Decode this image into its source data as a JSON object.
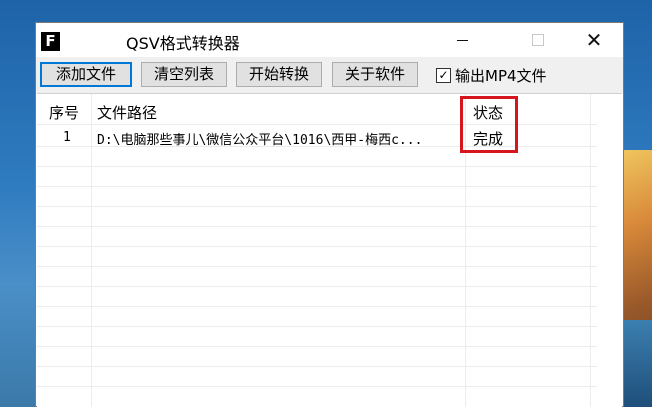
{
  "window": {
    "title": "QSV格式转换器",
    "icon_letter": "F"
  },
  "toolbar": {
    "add_file": "添加文件",
    "clear_list": "清空列表",
    "start_convert": "开始转换",
    "about": "关于软件",
    "output_mp4_label": "输出MP4文件",
    "output_mp4_checked": true
  },
  "table": {
    "columns": [
      "序号",
      "文件路径",
      "状态"
    ],
    "rows": [
      {
        "index": "1",
        "path": "D:\\电脑那些事儿\\微信公众平台\\1016\\西甲-梅西c...",
        "status": "完成"
      }
    ]
  },
  "colors": {
    "highlight": "#d6161c",
    "focus": "#0078d7"
  },
  "icons": {
    "minimize": "minimize-icon",
    "maximize": "maximize-icon",
    "close": "close-icon",
    "checkbox": "checkbox-checked-icon"
  }
}
